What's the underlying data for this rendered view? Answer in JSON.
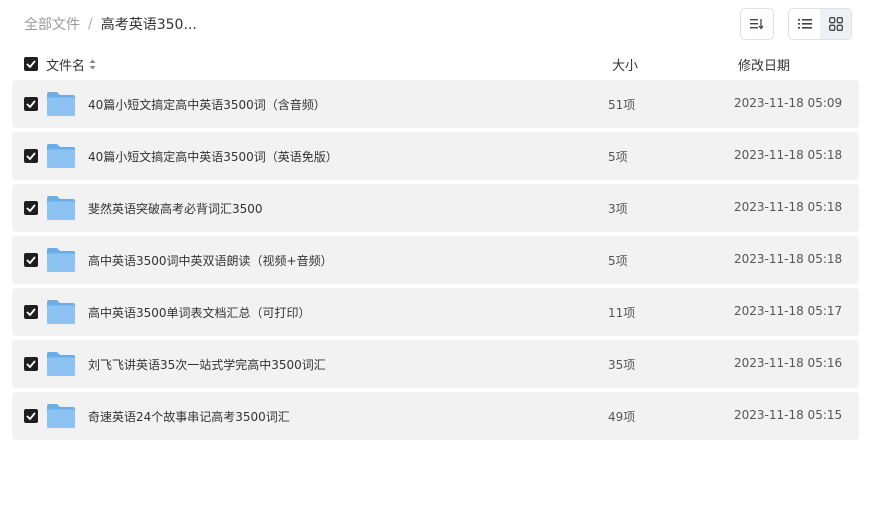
{
  "breadcrumb": {
    "root": "全部文件",
    "separator": "/",
    "current": "高考英语350..."
  },
  "toolbar": {
    "sort_icon": "sort-icon",
    "list_view_icon": "list-view-icon",
    "grid_view_icon": "grid-view-icon"
  },
  "header": {
    "name": "文件名",
    "size": "大小",
    "date": "修改日期"
  },
  "colors": {
    "row_bg": "#f2f2f2",
    "checkbox": "#1f1f1f",
    "folder_front": "#8cc3f2",
    "folder_back": "#6aaee9"
  },
  "files": [
    {
      "name": "40篇小短文搞定高中英语3500词（含音频）",
      "size": "51项",
      "date": "2023-11-18 05:09",
      "checked": true
    },
    {
      "name": "40篇小短文搞定高中英语3500词（英语免版）",
      "size": "5项",
      "date": "2023-11-18 05:18",
      "checked": true
    },
    {
      "name": "斐然英语突破高考必背词汇3500",
      "size": "3项",
      "date": "2023-11-18 05:18",
      "checked": true
    },
    {
      "name": "高中英语3500词中英双语朗读（视频+音频）",
      "size": "5项",
      "date": "2023-11-18 05:18",
      "checked": true
    },
    {
      "name": "高中英语3500单词表文档汇总（可打印）",
      "size": "11项",
      "date": "2023-11-18 05:17",
      "checked": true
    },
    {
      "name": "刘飞飞讲英语35次一站式学完高中3500词汇",
      "size": "35项",
      "date": "2023-11-18 05:16",
      "checked": true
    },
    {
      "name": "奇速英语24个故事串记高考3500词汇",
      "size": "49项",
      "date": "2023-11-18 05:15",
      "checked": true
    }
  ]
}
